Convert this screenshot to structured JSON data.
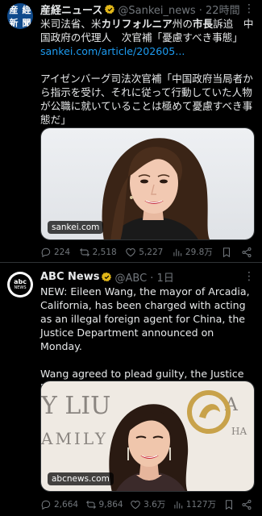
{
  "tweets": [
    {
      "avatar_chars": [
        "産",
        "經",
        "新",
        "聞"
      ],
      "name": "産経ニュース",
      "handle": "@Sankei_news · 22時間",
      "text_a": "米司法省、米",
      "text_bold_a": "カリフォルニア",
      "text_b": "州の",
      "text_bold_b": "市長",
      "text_c": "訴追　中国政府の代理人　次官補「憂慮すべき事態」",
      "link": "sankei.com/article/202605...",
      "quote": "アイゼンバーグ司法次官補「中国政府当局者から指示を受け、それに従って行動していた人物が公職に就いていることは極めて憂慮すべき事態だ」",
      "media_label": "sankei.com",
      "actions": {
        "replies": "224",
        "reposts": "2,518",
        "likes": "5,227",
        "views": "29.8万"
      }
    },
    {
      "avatar_l1": "abc",
      "avatar_l2": "NEWS",
      "name": "ABC News",
      "handle": "@ABC · 1日",
      "text": "NEW: Eileen Wang, the mayor of Arcadia, California, has been charged with acting as an illegal foreign agent for China, the Justice Department announced on Monday.\n\nWang agreed to plead guilty, the Justice Department said.",
      "backdrop_text_1": "Y LIU",
      "backdrop_text_2": "AMILY",
      "backdrop_text_3": "A",
      "backdrop_text_4": "HA",
      "media_label": "abcnews.com",
      "actions": {
        "replies": "2,664",
        "reposts": "9,864",
        "likes": "3.6万",
        "views": "1127万"
      }
    }
  ],
  "colors": {
    "background": "#000000",
    "text": "#e7e9ea",
    "muted": "#71767b",
    "link": "#1d9bf0",
    "verified": "#e2b719"
  }
}
